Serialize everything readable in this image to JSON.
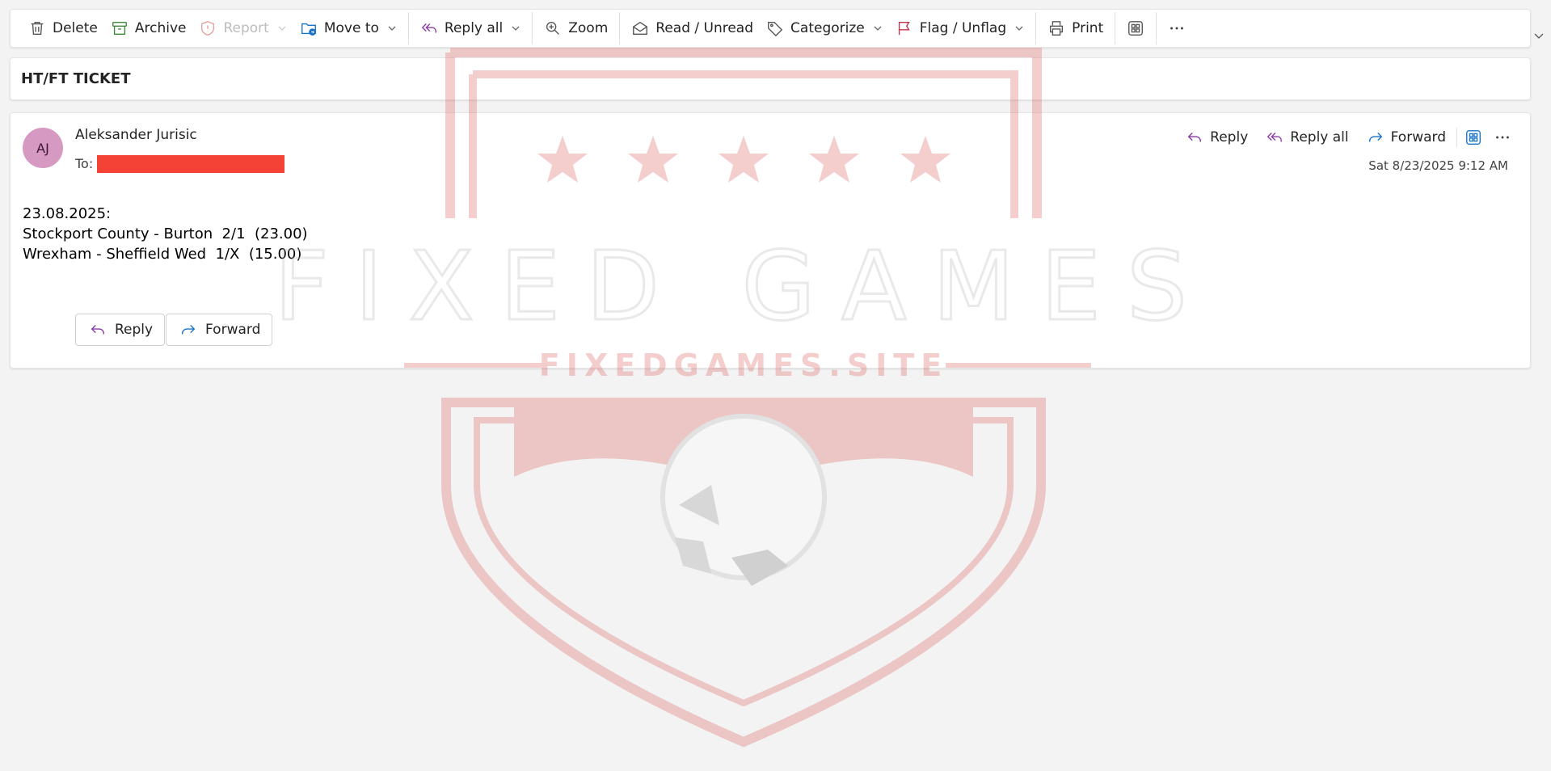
{
  "ribbon": {
    "delete": "Delete",
    "archive": "Archive",
    "report": "Report",
    "move_to": "Move to",
    "reply_all": "Reply all",
    "zoom": "Zoom",
    "read_unread": "Read / Unread",
    "categorize": "Categorize",
    "flag_unflag": "Flag / Unflag",
    "print": "Print"
  },
  "subject": "HT/FT TICKET",
  "message": {
    "avatar_initials": "AJ",
    "sender": "Aleksander Jurisic",
    "to_label": "To:",
    "date": "Sat 8/23/2025 9:12 AM",
    "actions": {
      "reply": "Reply",
      "reply_all": "Reply all",
      "forward": "Forward"
    },
    "body_lines": [
      "23.08.2025:",
      "Stockport County - Burton  2/1  (23.00)",
      "Wrexham - Sheffield Wed  1/X  (15.00)"
    ],
    "quick_reply": "Reply",
    "quick_forward": "Forward"
  },
  "watermark": {
    "title": "FIXED GAMES",
    "site": "FIXEDGAMES.SITE"
  },
  "colors": {
    "accent_purple": "#8a3aa6",
    "accent_blue": "#1a73c9",
    "avatar_bg": "#d69ac2",
    "redaction": "#f44336",
    "watermark_red": "#e06666"
  }
}
